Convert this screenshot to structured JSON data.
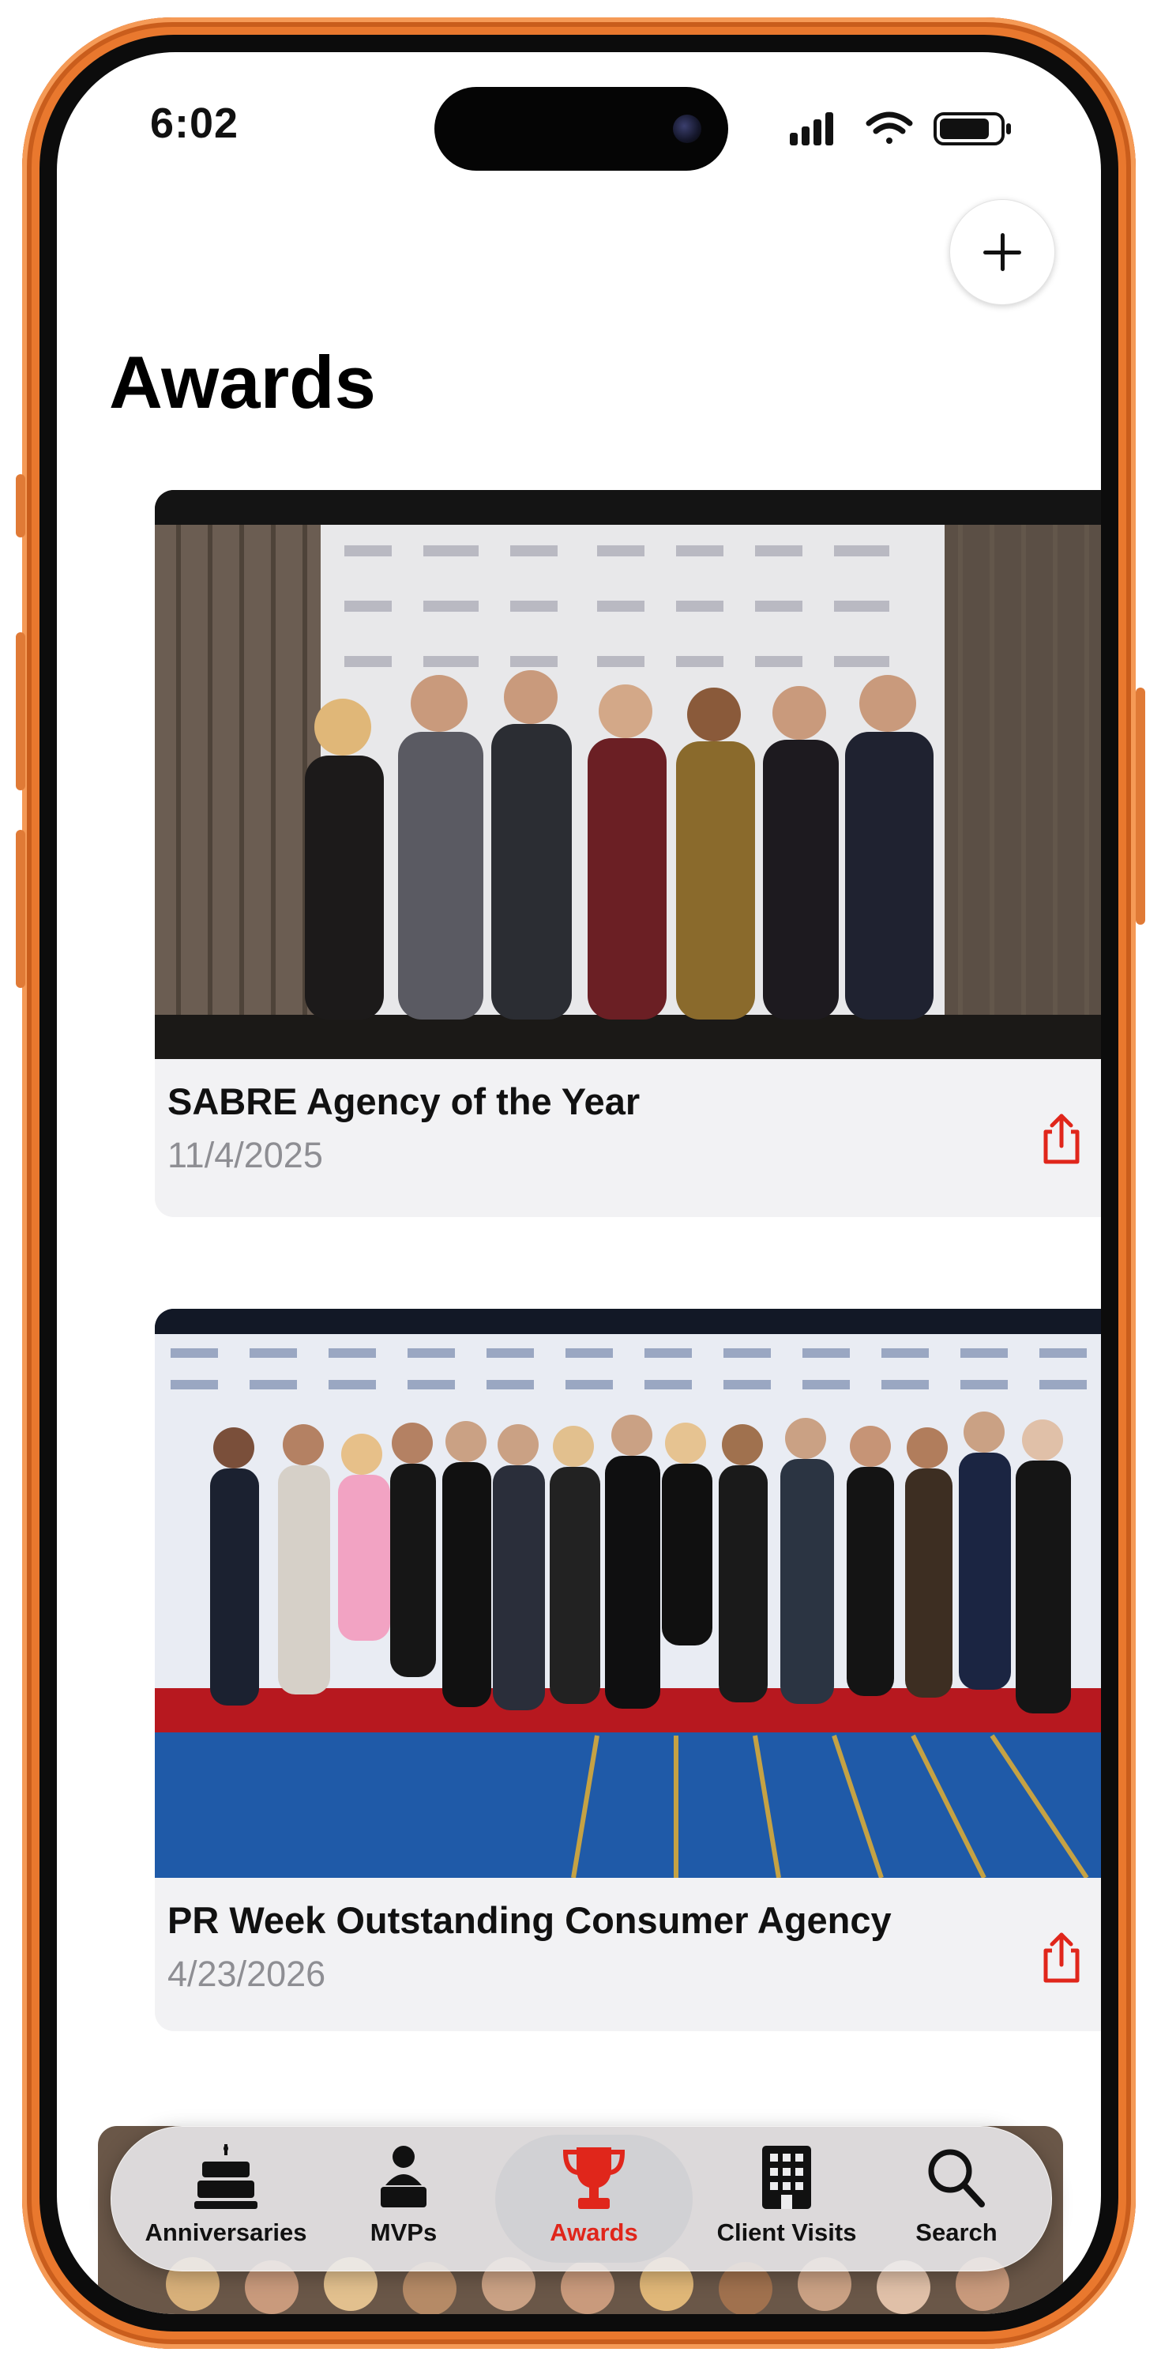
{
  "status_bar": {
    "time": "6:02"
  },
  "header": {
    "title": "Awards",
    "add_icon": "plus-icon"
  },
  "awards": [
    {
      "title": "SABRE Agency of the Year",
      "date": "11/4/2025",
      "share_icon": "share-icon"
    },
    {
      "title": "PR Week Outstanding Consumer Agency",
      "date": "4/23/2026",
      "share_icon": "share-icon"
    }
  ],
  "tabs": [
    {
      "label": "Anniversaries",
      "icon": "cake-icon"
    },
    {
      "label": "MVPs",
      "icon": "person-podium-icon"
    },
    {
      "label": "Awards",
      "icon": "trophy-icon",
      "active": true
    },
    {
      "label": "Client Visits",
      "icon": "building-icon"
    },
    {
      "label": "Search",
      "icon": "search-icon"
    }
  ],
  "colors": {
    "accent": "#e0261b",
    "frame": "#e9782e",
    "backdrop_blue": "#1f5aa8"
  }
}
